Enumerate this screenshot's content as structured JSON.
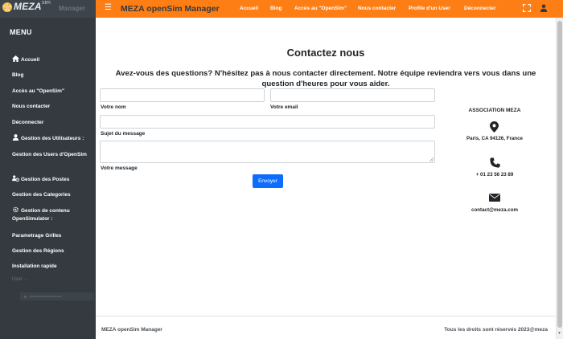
{
  "sidebar": {
    "logo_text": "MEZA",
    "logo_sup": "sim",
    "logo_manager": "Manager",
    "menu_title": "MENU",
    "items": [
      {
        "label": "Accueil"
      },
      {
        "label": "Blog"
      },
      {
        "label": "Accès au \"OpenSim\""
      },
      {
        "label": "Nous contacter"
      },
      {
        "label": "Déconnecter"
      },
      {
        "label": "Gestion des Utilisateurs :"
      },
      {
        "label": "Gestion des Users d'OpenSim"
      },
      {
        "label": "Gestion des Postes"
      },
      {
        "label": "Gestion des Categories"
      },
      {
        "label": "Gestion de contenu OpenSimulator :"
      },
      {
        "label": "Parametrage Grilles"
      },
      {
        "label": "Gestion des Régions"
      },
      {
        "label": "Installation rapide"
      }
    ],
    "user_arrow": "User →"
  },
  "topbar": {
    "brand": "MEZA openSim Manager",
    "links": [
      "Accueil",
      "Blog",
      "Accès au \"OpenSim\"",
      "Nous contacter",
      "Profile d'un User",
      "Déconnecter"
    ]
  },
  "main": {
    "title": "Contactez nous",
    "intro": "Avez-vous des questions? N'hésitez pas à nous contacter directement. Notre équipe reviendra vers vous dans une question d'heures pour vous aider.",
    "form": {
      "name_label": "Votre nom",
      "email_label": "Votre email",
      "subject_label": "Sujet du message",
      "message_label": "Votre message",
      "send_label": "Envoyer"
    },
    "contact": {
      "org": "ASSOCIATION MEZA",
      "address": "Paris, CA 94126, France",
      "phone": "+ 01 23 56 23 89",
      "email": "contact@meza.com"
    }
  },
  "footer": {
    "left": "MEZA openSim Manager",
    "right": "Tous les droits sont réservés 2023@meza"
  },
  "colors": {
    "topbar": "#fd7e14",
    "sidebar": "#343a40",
    "primary_button": "#0d6efd"
  }
}
